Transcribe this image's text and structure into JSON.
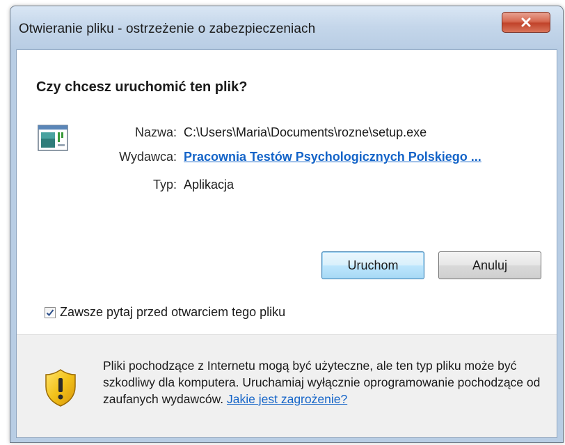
{
  "window": {
    "title": "Otwieranie pliku - ostrzeżenie o zabezpieczeniach"
  },
  "dialog": {
    "question": "Czy chcesz uruchomić ten plik?",
    "file_icon": "application-window-icon",
    "fields": {
      "name_label": "Nazwa:",
      "name_value": "C:\\Users\\Maria\\Documents\\rozne\\setup.exe",
      "publisher_label": "Wydawca:",
      "publisher_value": "Pracownia Testów Psychologicznych Polskiego ...",
      "type_label": "Typ:",
      "type_value": "Aplikacja"
    },
    "buttons": {
      "run": "Uruchom",
      "cancel": "Anuluj"
    },
    "checkbox": {
      "label": "Zawsze pytaj przed otwarciem tego pliku",
      "checked": true
    }
  },
  "footer": {
    "icon": "security-shield-warning-icon",
    "warning_text": "Pliki pochodzące z Internetu mogą być użyteczne, ale ten typ pliku może być szkodliwy dla komputera. Uruchamiaj wyłącznie oprogramowanie pochodzące od zaufanych wydawców.",
    "link_text": "Jakie jest zagrożenie?"
  },
  "colors": {
    "link": "#1464c8",
    "close_button": "#c1432a",
    "default_button": "#a7d9f5",
    "shield_yellow": "#f2c21a"
  }
}
